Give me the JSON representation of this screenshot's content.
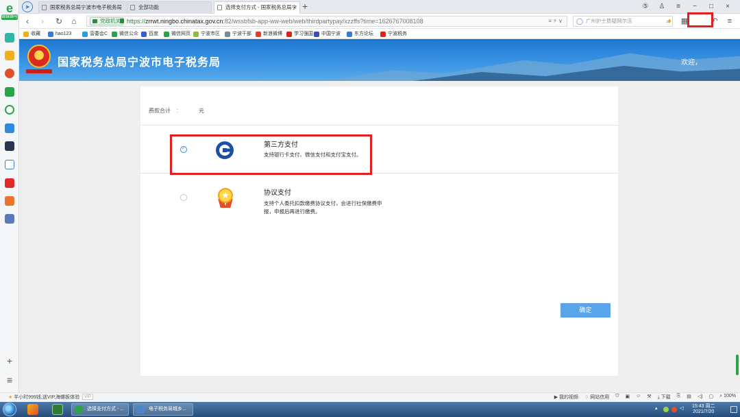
{
  "rail": {
    "logo_letter": "e",
    "logo_tag": "锦锦锦号"
  },
  "tabs": [
    {
      "label": "国家税务总局宁波市电子税务局",
      "active": false
    },
    {
      "label": "全部功能",
      "active": false
    },
    {
      "label": "选择支付方式 - 国家税务总局宁",
      "active": true
    }
  ],
  "window": {
    "close": "×",
    "minimize": "−",
    "restore": "□"
  },
  "address": {
    "cert_label": "党政机关",
    "protocol": "https://",
    "host": "zrrwt.ningbo.chinatax.gov.cn",
    "path": ":82/wssbfsb-app-ww-web/web/thirdpartypay/xzzffs?time=1626767008108",
    "tools": "≡  ⚡  ∨"
  },
  "search": {
    "placeholder": "广州护士质疑网尔活"
  },
  "bookmarks": [
    {
      "label": "收藏",
      "color": "#f2b01e"
    },
    {
      "label": "hao123",
      "color": "#3a7bd5"
    },
    {
      "label": "营委会C",
      "color": "#2d9bd6"
    },
    {
      "label": "微信公众",
      "color": "#2aa34a"
    },
    {
      "label": "百度",
      "color": "#3a5bd5"
    },
    {
      "label": "微信网页",
      "color": "#2aa34a"
    },
    {
      "label": "宁波市区",
      "color": "#8bbf3a"
    },
    {
      "label": "宁波干部",
      "color": "#7b8a99"
    },
    {
      "label": "新浪微博",
      "color": "#e0402a"
    },
    {
      "label": "学习强国",
      "color": "#d8261b"
    },
    {
      "label": "中国宁波",
      "color": "#3a4fbf"
    },
    {
      "label": "东方论坛",
      "color": "#3a7bd5"
    },
    {
      "label": "宁波税务",
      "color": "#d8261b"
    }
  ],
  "header": {
    "title": "国家税务总局宁波市电子税务局",
    "welcome": "欢迎，"
  },
  "form": {
    "total_label": "费款合计",
    "total_colon": "：",
    "total_unit": "元",
    "options": [
      {
        "title": "第三方支付",
        "desc": "支持银行卡支付、微信支付和支付宝支付。",
        "selected": true,
        "icon": "ccb-bank-icon"
      },
      {
        "title": "协议支付",
        "desc": "支持个人委托扣款缴费协议支付，会进行社保缴费申报，申报后再进行缴费。",
        "selected": false,
        "icon": "medal-icon"
      }
    ],
    "confirm_label": "确定"
  },
  "status": {
    "left_text": "半小时999钱,送VIP,海螺板体验",
    "right_items": [
      "我的视频",
      "网站信用",
      "下载",
      "100%"
    ]
  },
  "taskbar": {
    "tasks": [
      {
        "label": "选择支付方式 - ...",
        "color": "#2aa34a"
      },
      {
        "label": "电子税务局城乡...",
        "color": "#4e86c8"
      }
    ],
    "time": "15:43 周二",
    "date": "2021/7/20"
  }
}
